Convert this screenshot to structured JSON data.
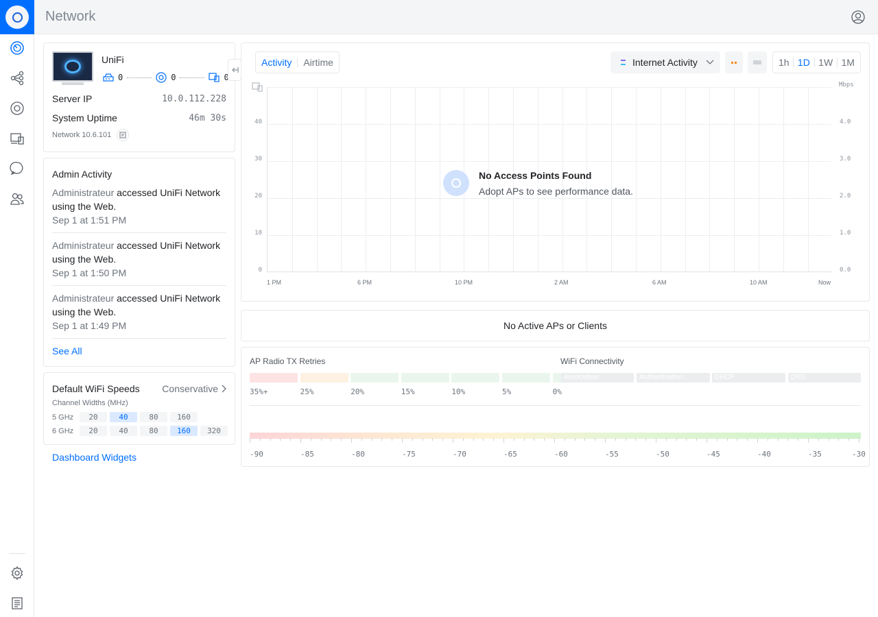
{
  "header": {
    "title": "Network"
  },
  "device": {
    "name": "UniFi",
    "gateway_count": "0",
    "ap_count": "0",
    "client_count": "0",
    "server_ip_label": "Server IP",
    "server_ip": "10.0.112.228",
    "uptime_label": "System Uptime",
    "uptime": "46m 30s",
    "version": "Network 10.6.101"
  },
  "admin": {
    "title": "Admin Activity",
    "entries": [
      {
        "user": "Administrateur",
        "action": "accessed UniFi Network",
        "line2": "using the Web.",
        "time": "Sep 1 at 1:51 PM"
      },
      {
        "user": "Administrateur",
        "action": "accessed UniFi Network",
        "line2": "using the Web.",
        "time": "Sep 1 at 1:50 PM"
      },
      {
        "user": "Administrateur",
        "action": "accessed UniFi Network",
        "line2": "using the Web.",
        "time": "Sep 1 at 1:49 PM"
      }
    ],
    "see_all": "See All"
  },
  "wifi": {
    "title": "Default WiFi Speeds",
    "mode": "Conservative",
    "channel_label": "Channel Widths (MHz)",
    "bands": [
      {
        "name": "5 GHz",
        "widths": [
          "20",
          "40",
          "80",
          "160"
        ],
        "selected": "40"
      },
      {
        "name": "6 GHz",
        "widths": [
          "20",
          "40",
          "80",
          "160",
          "320"
        ],
        "selected": "160"
      }
    ]
  },
  "dashboard_widgets": "Dashboard Widgets",
  "tabs": {
    "activity": "Activity",
    "airtime": "Airtime"
  },
  "metric_select": "Internet Activity",
  "ranges": [
    "1h",
    "1D",
    "1W",
    "1M"
  ],
  "active_range": "1D",
  "chart_data": {
    "type": "line",
    "series": [],
    "empty_title": "No Access Points Found",
    "empty_sub": "Adopt APs to see performance data.",
    "y_left_ticks": [
      "40",
      "30",
      "20",
      "10",
      "0"
    ],
    "y_right_label": "Mbps",
    "y_right_ticks": [
      "4.0",
      "3.0",
      "2.0",
      "1.0",
      "0.0"
    ],
    "x_ticks": [
      "1 PM",
      "6 PM",
      "10 PM",
      "2 AM",
      "6 AM",
      "10 AM",
      "Now"
    ]
  },
  "no_active": "No Active APs or Clients",
  "tx": {
    "title": "AP Radio TX Retries",
    "labels": [
      "35%+",
      "25%",
      "20%",
      "15%",
      "10%",
      "5%",
      "0%"
    ],
    "colors": [
      "#fde3e4",
      "#fdf1e2",
      "#eaf6ed",
      "#eaf6ed",
      "#eaf6ed",
      "#eaf6ed",
      "#eaf6ed"
    ]
  },
  "conn": {
    "title": "WiFi Connectivity",
    "stages": [
      "Association",
      "Authentication",
      "DHCP",
      "DNS"
    ]
  },
  "signal_scale": [
    "-90",
    "-85",
    "-80",
    "-75",
    "-70",
    "-65",
    "-60",
    "-55",
    "-50",
    "-45",
    "-40",
    "-35",
    "-30"
  ]
}
